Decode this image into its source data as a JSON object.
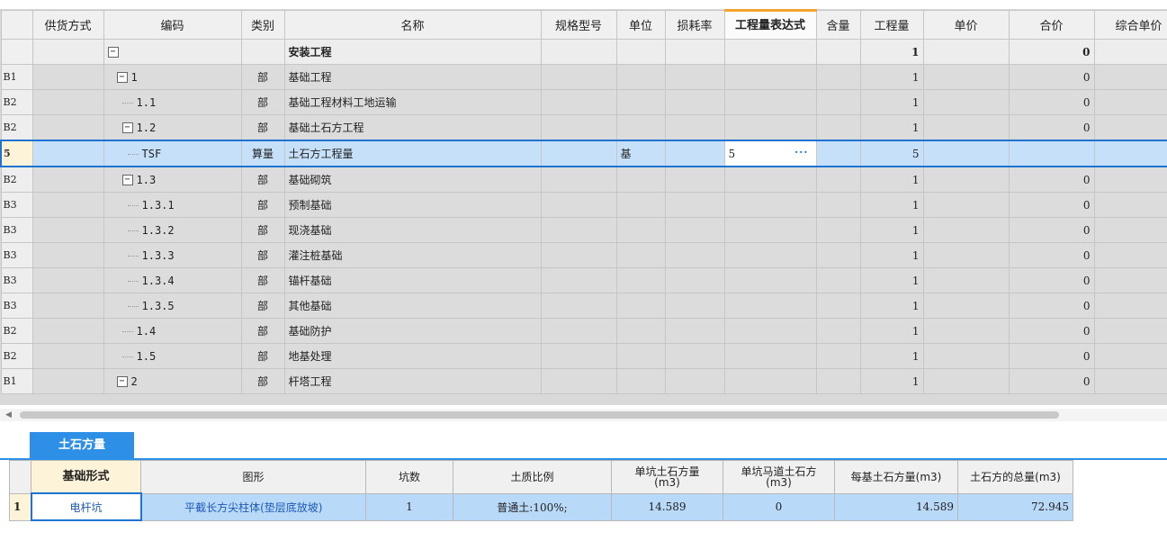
{
  "grid": {
    "headers": [
      "",
      "供货方式",
      "编码",
      "类别",
      "名称",
      "规格型号",
      "单位",
      "损耗率",
      "工程量表达式",
      "含量",
      "工程量",
      "单价",
      "合价",
      "综合单价"
    ],
    "rows": [
      {
        "rn": "",
        "code": "",
        "type": "",
        "name": "安装工程",
        "unit": "",
        "expr": "",
        "qty": "1",
        "total": "0"
      },
      {
        "rn": "B1",
        "code": "1",
        "type": "部",
        "name": "基础工程",
        "unit": "",
        "expr": "",
        "qty": "1",
        "total": "0"
      },
      {
        "rn": "B2",
        "code": "1.1",
        "type": "部",
        "name": "基础工程材料工地运输",
        "unit": "",
        "expr": "",
        "qty": "1",
        "total": "0"
      },
      {
        "rn": "B2",
        "code": "1.2",
        "type": "部",
        "name": "基础土石方工程",
        "unit": "",
        "expr": "",
        "qty": "1",
        "total": "0"
      },
      {
        "rn": "5",
        "code": "TSF",
        "type": "算量",
        "name": "土石方工程量",
        "unit": "基",
        "expr": "5",
        "qty": "5",
        "total": ""
      },
      {
        "rn": "B2",
        "code": "1.3",
        "type": "部",
        "name": "基础砌筑",
        "unit": "",
        "expr": "",
        "qty": "1",
        "total": "0"
      },
      {
        "rn": "B3",
        "code": "1.3.1",
        "type": "部",
        "name": "预制基础",
        "unit": "",
        "expr": "",
        "qty": "1",
        "total": "0"
      },
      {
        "rn": "B3",
        "code": "1.3.2",
        "type": "部",
        "name": "现浇基础",
        "unit": "",
        "expr": "",
        "qty": "1",
        "total": "0"
      },
      {
        "rn": "B3",
        "code": "1.3.3",
        "type": "部",
        "name": "灌注桩基础",
        "unit": "",
        "expr": "",
        "qty": "1",
        "total": "0"
      },
      {
        "rn": "B3",
        "code": "1.3.4",
        "type": "部",
        "name": "锚杆基础",
        "unit": "",
        "expr": "",
        "qty": "1",
        "total": "0"
      },
      {
        "rn": "B3",
        "code": "1.3.5",
        "type": "部",
        "name": "其他基础",
        "unit": "",
        "expr": "",
        "qty": "1",
        "total": "0"
      },
      {
        "rn": "B2",
        "code": "1.4",
        "type": "部",
        "name": "基础防护",
        "unit": "",
        "expr": "",
        "qty": "1",
        "total": "0"
      },
      {
        "rn": "B2",
        "code": "1.5",
        "type": "部",
        "name": "地基处理",
        "unit": "",
        "expr": "",
        "qty": "1",
        "total": "0"
      },
      {
        "rn": "B1",
        "code": "2",
        "type": "部",
        "name": "杆塔工程",
        "unit": "",
        "expr": "",
        "qty": "1",
        "total": "0"
      }
    ],
    "expr_button": "···",
    "collapse_symbol": "−"
  },
  "panel": {
    "tab_label": "土石方量",
    "headers": [
      "",
      "基础形式",
      "图形",
      "坑数",
      "土质比例",
      "单坑土石方量\n(m3)",
      "单坑马道土石方\n(m3)",
      "每基土石方量(m3)",
      "土石方的总量(m3)"
    ],
    "row": {
      "rn": "1",
      "form": "电杆坑",
      "shape": "平截长方尖柱体(垫层底放坡)",
      "pits": "1",
      "soil": "普通土:100%;",
      "single": "14.589",
      "ramp": "0",
      "per_base": "14.589",
      "total": "72.945"
    }
  }
}
